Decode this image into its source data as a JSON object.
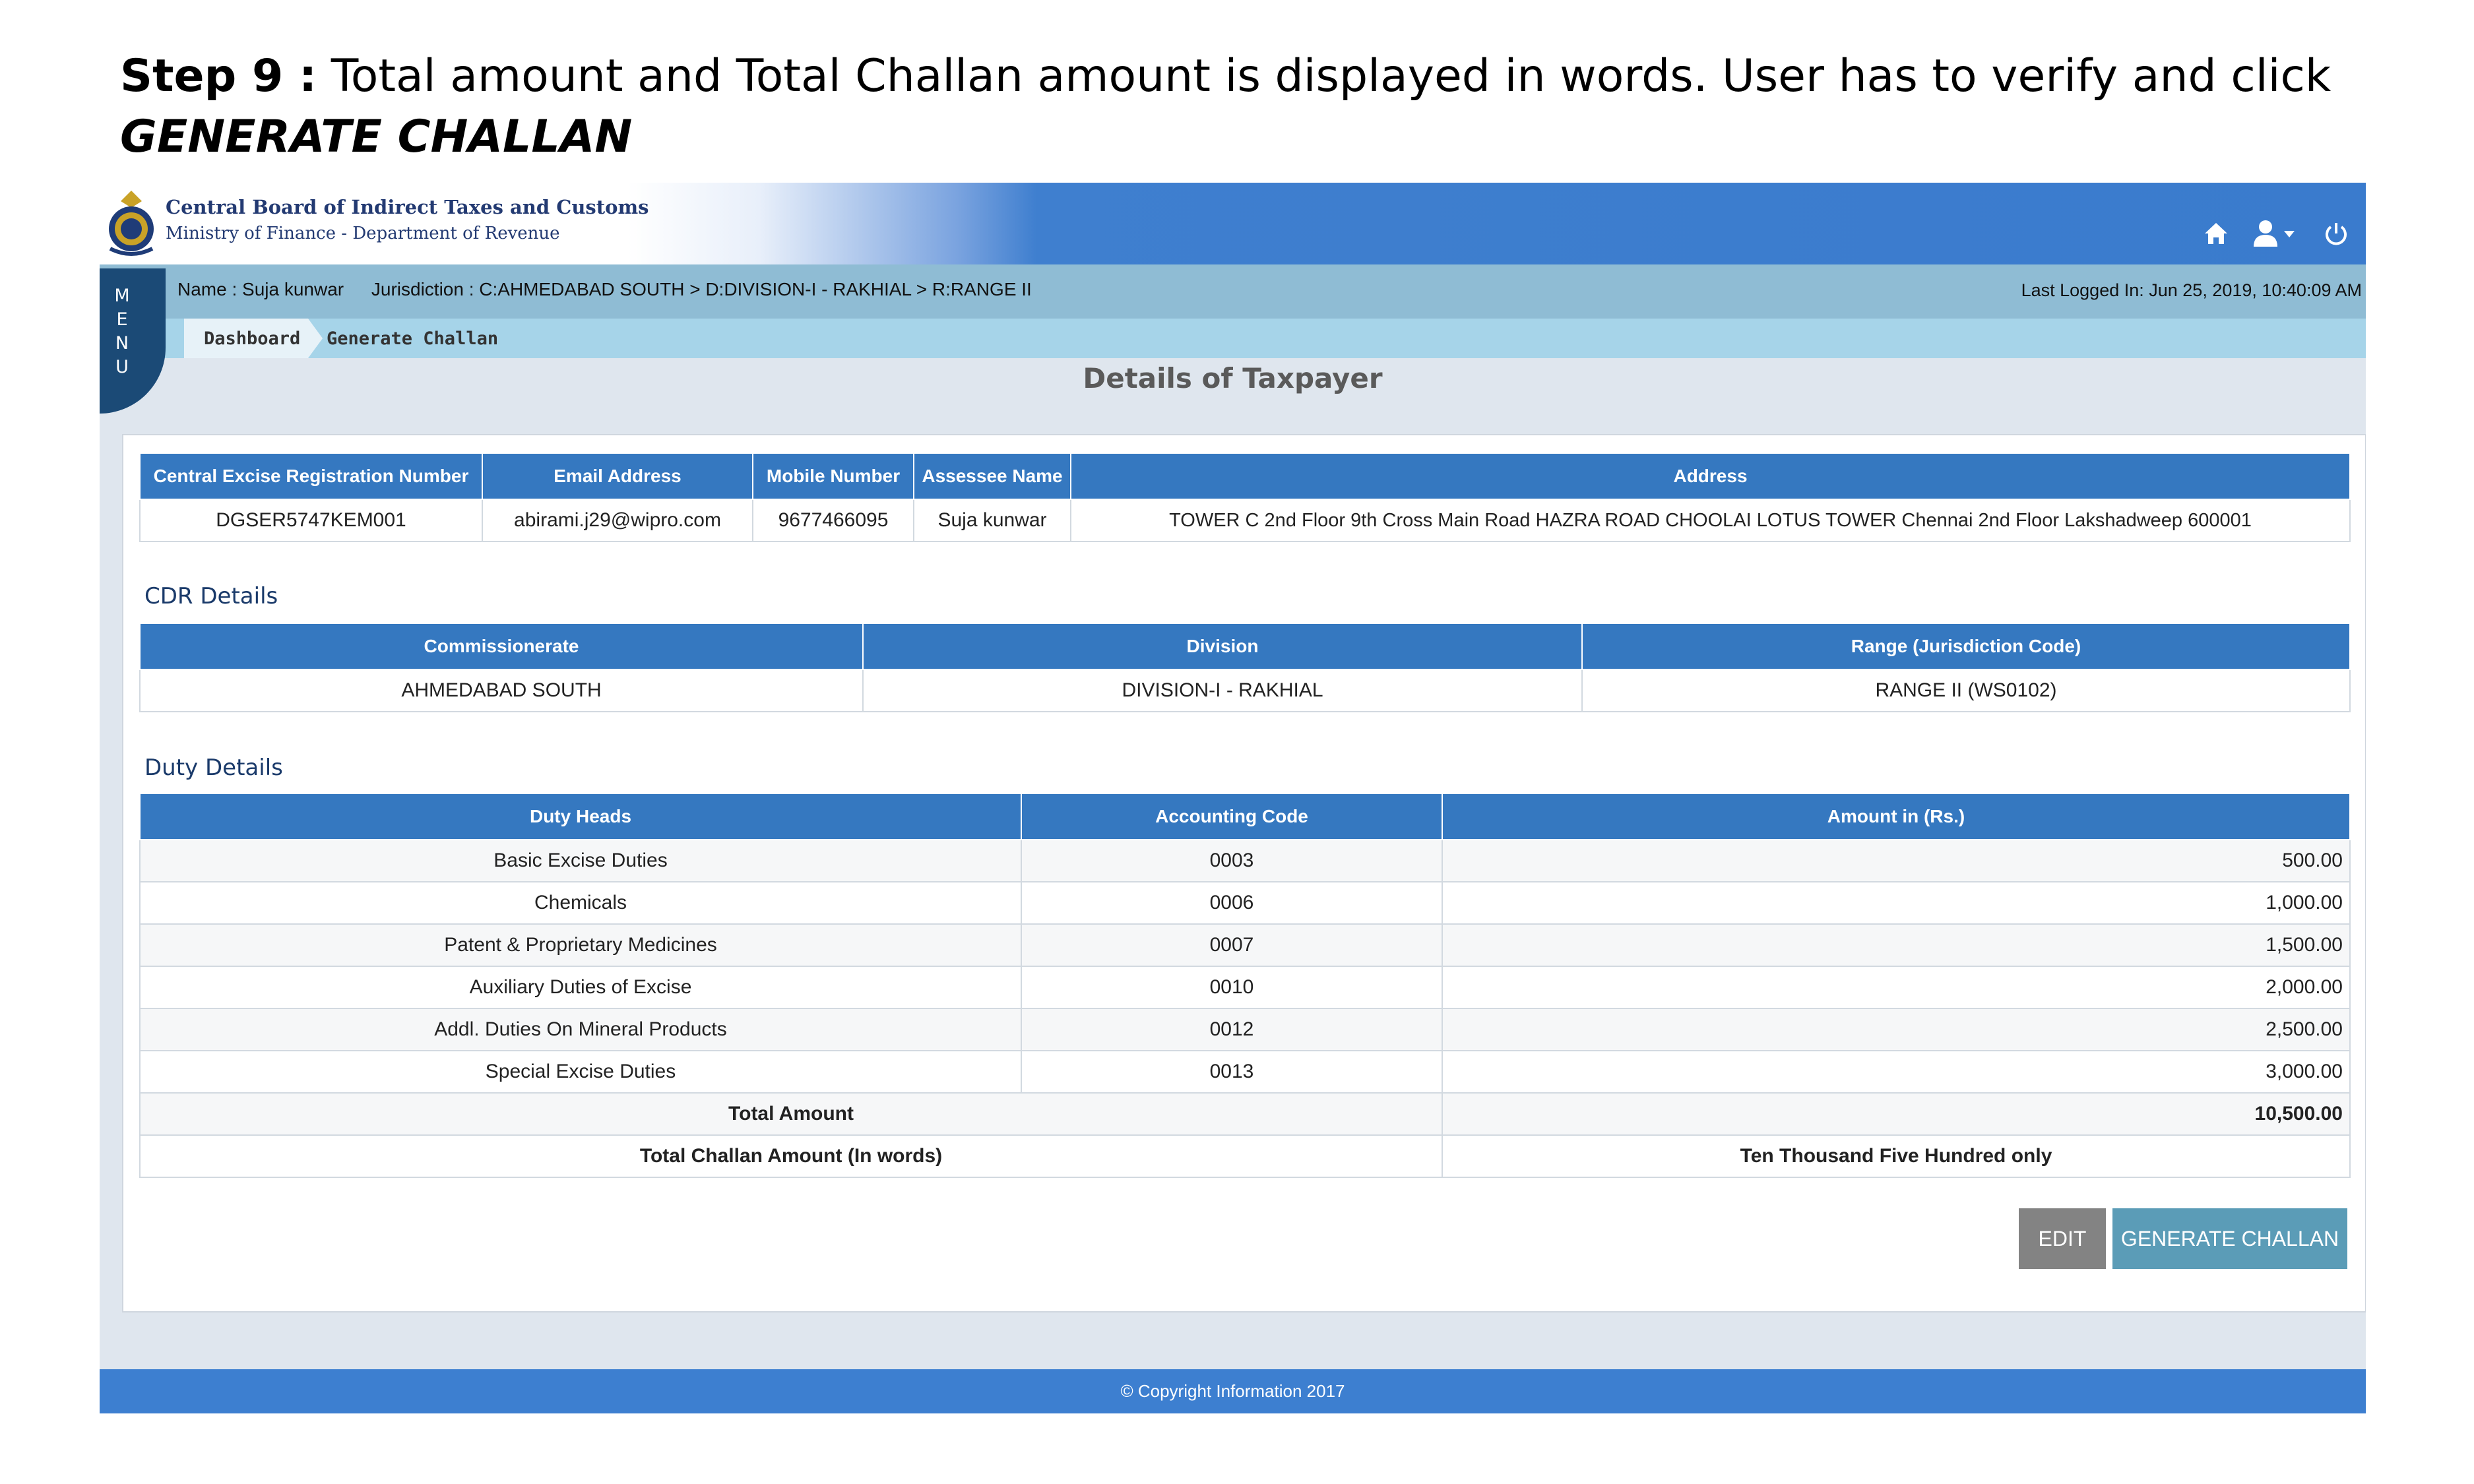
{
  "slide": {
    "step_label": "Step 9 :",
    "instruction": "Total amount and Total Challan amount is displayed in words. User has to verify and click",
    "action_text": "GENERATE CHALLAN"
  },
  "header": {
    "org_name": "Central Board of Indirect Taxes and Customs",
    "org_subtitle": "Ministry of Finance - Department of Revenue",
    "icons": [
      "home-icon",
      "user-icon",
      "power-icon"
    ]
  },
  "userbar": {
    "name": "Name : Suja kunwar",
    "jurisdiction": "Jurisdiction : C:AHMEDABAD SOUTH > D:DIVISION-I - RAKHIAL > R:RANGE II",
    "last_logged": "Last Logged In: Jun 25, 2019, 10:40:09 AM"
  },
  "breadcrumb": {
    "home": "Dashboard",
    "current": "Generate Challan"
  },
  "menu": {
    "letters": [
      "M",
      "E",
      "N",
      "U"
    ]
  },
  "page_title": "Details of Taxpayer",
  "taxpayer": {
    "headers": [
      "Central Excise Registration Number",
      "Email Address",
      "Mobile Number",
      "Assessee Name",
      "Address"
    ],
    "row": [
      "DGSER5747KEM001",
      "abirami.j29@wipro.com",
      "9677466095",
      "Suja kunwar",
      "TOWER C 2nd Floor 9th Cross Main Road HAZRA ROAD CHOOLAI LOTUS TOWER Chennai 2nd Floor Lakshadweep 600001"
    ]
  },
  "cdr": {
    "title": "CDR Details",
    "headers": [
      "Commissionerate",
      "Division",
      "Range (Jurisdiction Code)"
    ],
    "row": [
      "AHMEDABAD SOUTH",
      "DIVISION-I - RAKHIAL",
      "RANGE II (WS0102)"
    ]
  },
  "duty": {
    "title": "Duty Details",
    "headers": [
      "Duty Heads",
      "Accounting Code",
      "Amount in (Rs.)"
    ],
    "rows": [
      [
        "Basic Excise Duties",
        "0003",
        "500.00"
      ],
      [
        "Chemicals",
        "0006",
        "1,000.00"
      ],
      [
        "Patent & Proprietary Medicines",
        "0007",
        "1,500.00"
      ],
      [
        "Auxiliary Duties of Excise",
        "0010",
        "2,000.00"
      ],
      [
        "Addl. Duties On Mineral Products",
        "0012",
        "2,500.00"
      ],
      [
        "Special Excise Duties",
        "0013",
        "3,000.00"
      ]
    ],
    "total_label": "Total Amount",
    "total_value": "10,500.00",
    "words_label": "Total Challan Amount (In words)",
    "words_value": "Ten Thousand Five Hundred only"
  },
  "buttons": {
    "edit": "EDIT",
    "generate": "GENERATE CHALLAN"
  },
  "footer": {
    "copyright": "© Copyright Information 2017"
  }
}
